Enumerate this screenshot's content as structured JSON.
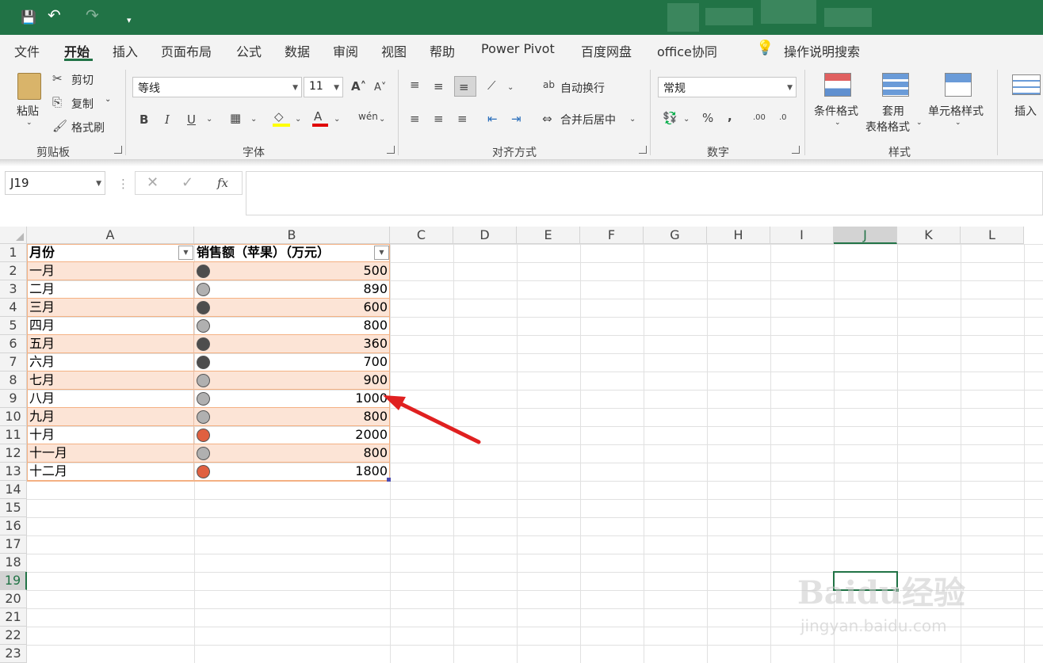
{
  "quick_access": {
    "save_icon": "💾",
    "undo_icon": "↶",
    "redo_icon": "↷",
    "customize_icon": "▾"
  },
  "menu": [
    "文件",
    "开始",
    "插入",
    "页面布局",
    "公式",
    "数据",
    "审阅",
    "视图",
    "帮助",
    "Power Pivot",
    "百度网盘",
    "office协同"
  ],
  "tell_me": "操作说明搜索",
  "ribbon": {
    "clipboard": {
      "paste": "粘贴",
      "cut": "剪切",
      "copy": "复制",
      "format_painter": "格式刷",
      "title": "剪贴板"
    },
    "font": {
      "name": "等线",
      "size": "11",
      "title": "字体"
    },
    "align": {
      "wrap": "自动换行",
      "merge": "合并后居中",
      "title": "对齐方式"
    },
    "number": {
      "format": "常规",
      "title": "数字"
    },
    "styles": {
      "cond": "条件格式",
      "table_fmt_1": "套用",
      "table_fmt_2": "表格格式",
      "cell_style": "单元格样式",
      "title": "样式"
    },
    "cells": {
      "insert": "插入"
    }
  },
  "formula_bar": {
    "name_box": "J19",
    "fx": "fx",
    "value": ""
  },
  "columns": [
    "A",
    "B",
    "C",
    "D",
    "E",
    "F",
    "G",
    "H",
    "I",
    "J",
    "K",
    "L"
  ],
  "selected_cell": "J19",
  "table": {
    "headers": [
      "月份",
      "销售额（苹果）（万元）"
    ],
    "rows": [
      {
        "month": "一月",
        "value": "500",
        "dot": "dark"
      },
      {
        "month": "二月",
        "value": "890",
        "dot": "gray"
      },
      {
        "month": "三月",
        "value": "600",
        "dot": "dark"
      },
      {
        "month": "四月",
        "value": "800",
        "dot": "gray"
      },
      {
        "month": "五月",
        "value": "360",
        "dot": "dark"
      },
      {
        "month": "六月",
        "value": "700",
        "dot": "dark"
      },
      {
        "month": "七月",
        "value": "900",
        "dot": "gray"
      },
      {
        "month": "八月",
        "value": "1000",
        "dot": "gray"
      },
      {
        "month": "九月",
        "value": "800",
        "dot": "gray"
      },
      {
        "month": "十月",
        "value": "2000",
        "dot": "red"
      },
      {
        "month": "十一月",
        "value": "800",
        "dot": "gray"
      },
      {
        "month": "十二月",
        "value": "1800",
        "dot": "red"
      }
    ]
  },
  "dot_colors": {
    "dark": "#4d4d4d",
    "gray": "#b0b0b0",
    "red": "#e06040"
  },
  "accent_color": "#217346",
  "watermark": {
    "brand": "Baidu经验",
    "url": "jingyan.baidu.com"
  }
}
